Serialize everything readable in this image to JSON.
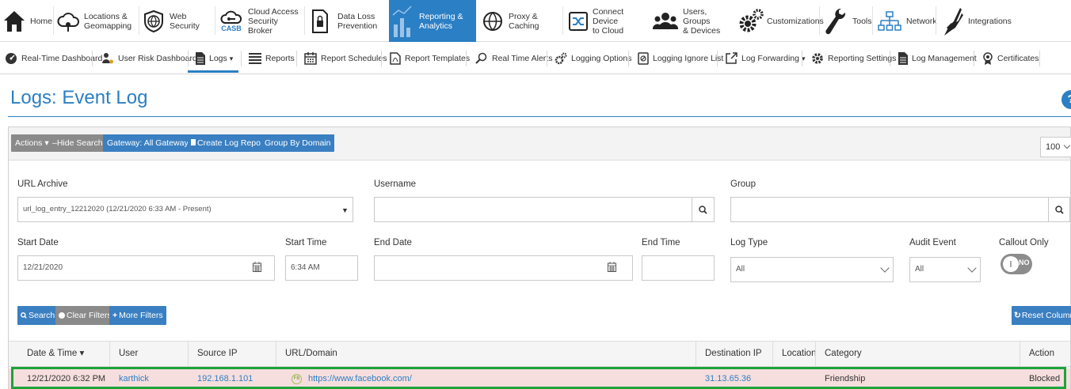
{
  "colors": {
    "brand": "#2b7fc4",
    "highlight": "#1da33a",
    "row_bg": "#f6dede",
    "gray_button": "#8a8a8a"
  },
  "topnav": [
    {
      "label": "Home",
      "icon": "home-icon",
      "active": false
    },
    {
      "label": "Locations &\nGeomapping",
      "icon": "cloud-pin-icon",
      "active": false
    },
    {
      "label": "Web Security",
      "icon": "globe-shield-icon",
      "active": false
    },
    {
      "label": "Cloud Access\nSecurity Broker",
      "icon": "casb-icon",
      "icon_text": "CASB",
      "active": false
    },
    {
      "label": "Data Loss\nPrevention",
      "icon": "lock-document-icon",
      "active": false
    },
    {
      "label": "Reporting &\nAnalytics",
      "icon": "bar-chart-icon",
      "active": true
    },
    {
      "label": "Proxy &\nCaching",
      "icon": "globe-icon",
      "active": false
    },
    {
      "label": "Connect Device\nto Cloud",
      "icon": "shuffle-icon",
      "active": false
    },
    {
      "label": "Users, Groups\n& Devices",
      "icon": "users-icon",
      "active": false
    },
    {
      "label": "Customizations",
      "icon": "gears-icon",
      "active": false
    },
    {
      "label": "Tools",
      "icon": "wrench-icon",
      "active": false
    },
    {
      "label": "Network",
      "icon": "network-icon",
      "active": false
    },
    {
      "label": "Integrations",
      "icon": "plug-icon",
      "active": false
    }
  ],
  "subnav": [
    {
      "label": "Real-Time Dashboard",
      "icon": "dashboard-icon"
    },
    {
      "label": "User Risk Dashboard",
      "icon": "user-risk-icon"
    },
    {
      "label": "Logs",
      "icon": "document-icon",
      "dropdown": "▾",
      "active": true
    },
    {
      "label": "Reports",
      "icon": "list-icon"
    },
    {
      "label": "Report Schedules",
      "icon": "calendar-icon"
    },
    {
      "label": "Report Templates",
      "icon": "pdf-icon"
    },
    {
      "label": "Real Time Alerts",
      "icon": "alert-search-icon"
    },
    {
      "label": "Logging Options",
      "icon": "cogs-icon"
    },
    {
      "label": "Logging Ignore List",
      "icon": "ignore-icon"
    },
    {
      "label": "Log Forwarding",
      "icon": "forward-icon",
      "dropdown": "▾"
    },
    {
      "label": "Reporting Settings",
      "icon": "gear-icon"
    },
    {
      "label": "Log Management",
      "icon": "document-icon"
    },
    {
      "label": "Certificates",
      "icon": "certificate-icon"
    }
  ],
  "page": {
    "title": "Logs: Event Log",
    "help": "?"
  },
  "toolbar": {
    "actions": "Actions ▾",
    "hide_search": "Hide Search",
    "gateway": "Gateway: All Gateways ▾",
    "create_report": "Create Log Report",
    "group_by_domain": "Group By Domain",
    "page_size": "100"
  },
  "filters": {
    "url_archive": {
      "label": "URL Archive",
      "value": "url_log_entry_12212020 (12/21/2020 6:33 AM - Present)"
    },
    "username": {
      "label": "Username",
      "value": ""
    },
    "group": {
      "label": "Group",
      "value": ""
    },
    "start_date": {
      "label": "Start Date",
      "value": "12/21/2020"
    },
    "start_time": {
      "label": "Start Time",
      "value": "6:34 AM"
    },
    "end_date": {
      "label": "End Date",
      "value": ""
    },
    "end_time": {
      "label": "End Time",
      "value": ""
    },
    "log_type": {
      "label": "Log Type",
      "value": "All"
    },
    "audit_event": {
      "label": "Audit Event",
      "value": "All"
    },
    "callout_only": {
      "label": "Callout Only",
      "value": "NO"
    }
  },
  "buttons": {
    "search": "Search",
    "clear_filters": "Clear Filters",
    "more_filters": "More Filters",
    "reset_columns": "Reset Columns"
  },
  "table": {
    "columns": [
      "Date & Time ▾",
      "User",
      "Source IP",
      "URL/Domain",
      "Destination IP",
      "Location",
      "Category",
      "Action"
    ],
    "rows": [
      [
        "12/21/2020 6:32 PM",
        "karthick",
        "192.168.1.101",
        "https://www.facebook.com/",
        "31.13.65.36",
        "",
        "Friendship",
        "Blocked"
      ]
    ],
    "url_icon_text": "FB"
  }
}
